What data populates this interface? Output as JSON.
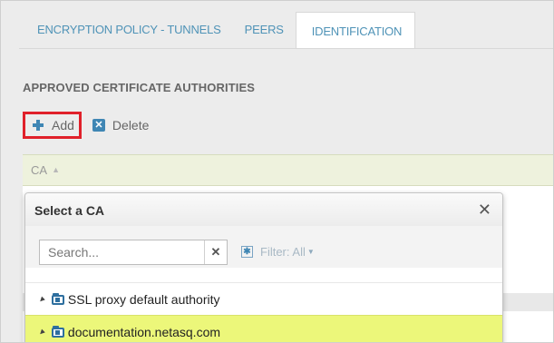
{
  "tabs": [
    {
      "label": "ENCRYPTION POLICY - TUNNELS",
      "active": false
    },
    {
      "label": "PEERS",
      "active": false
    },
    {
      "label": "IDENTIFICATION",
      "active": true
    }
  ],
  "section": {
    "title": "APPROVED CERTIFICATE AUTHORITIES"
  },
  "toolbar": {
    "add_label": "Add",
    "delete_label": "Delete",
    "delete_icon_glyph": "✕"
  },
  "grid": {
    "column_header": "CA",
    "sort_glyph": "▲"
  },
  "popup": {
    "title": "Select a CA",
    "close_glyph": "✕",
    "search_placeholder": "Search...",
    "clear_glyph": "✕",
    "filter_icon_glyph": "✱",
    "filter_label": "Filter: All",
    "filter_caret_glyph": "▼",
    "items": [
      {
        "label": "SSL proxy default authority",
        "selected": false,
        "icon": "folder-certificate-icon"
      },
      {
        "label": "documentation.netasq.com",
        "selected": true,
        "icon": "folder-certificate-icon"
      }
    ],
    "expand_glyph": "◢"
  },
  "colors": {
    "accent": "#3f86b4",
    "highlight_border": "#e0202a",
    "selected_row": "#ecf77a",
    "header_row": "#eef2dd",
    "tab_text": "#4f93b7"
  }
}
